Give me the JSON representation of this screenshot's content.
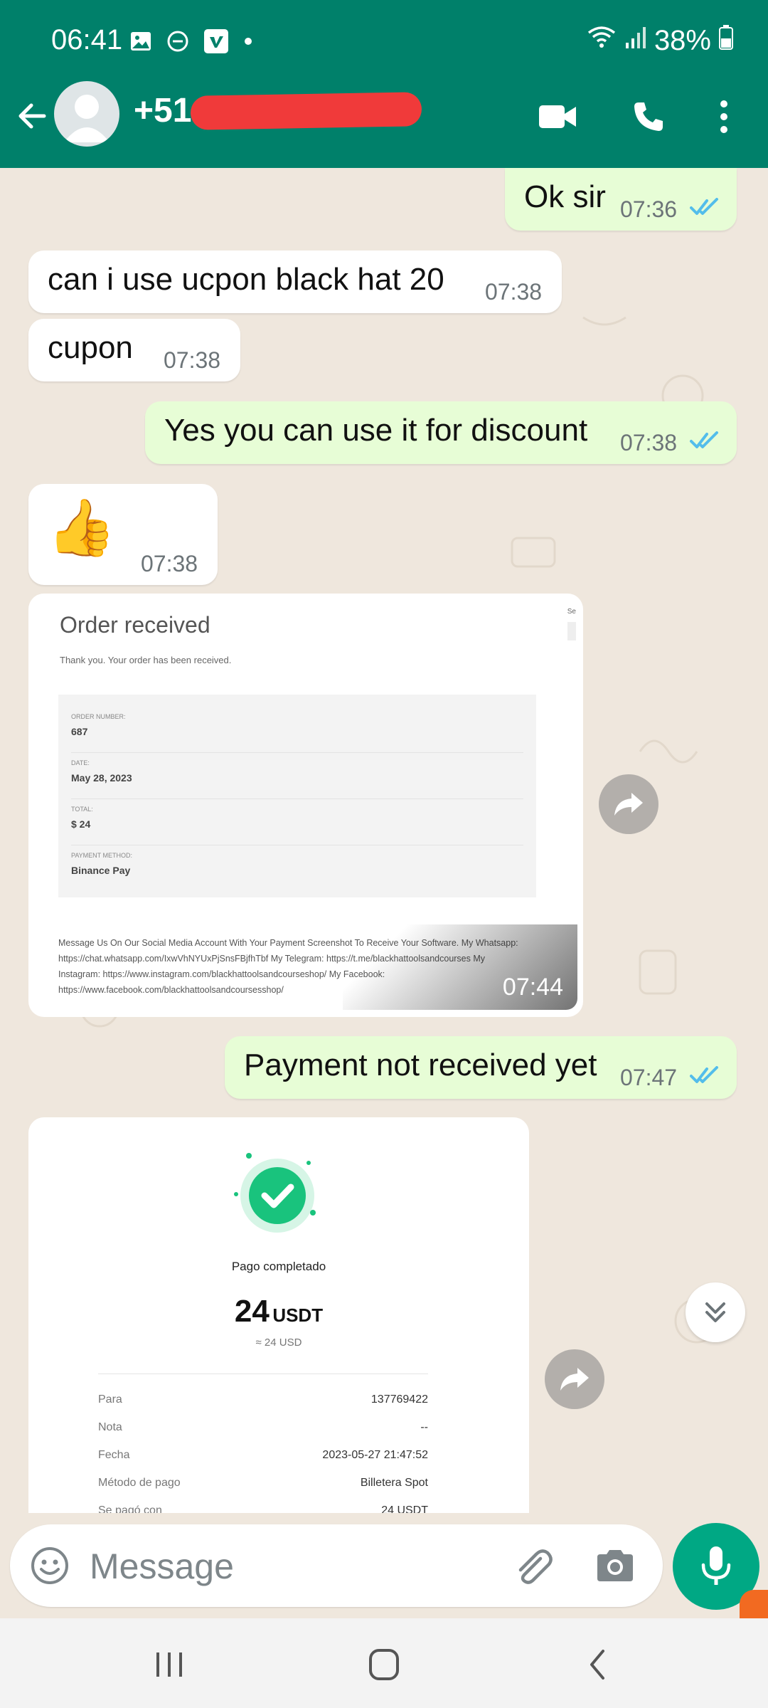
{
  "status_bar": {
    "time": "06:41",
    "battery": "38%",
    "icons": [
      "gallery-icon",
      "dnd-icon",
      "vimeo-icon",
      "dot-icon",
      "wifi-icon",
      "signal-icon",
      "battery-icon"
    ]
  },
  "header": {
    "contact": "+51 ",
    "icons": [
      "back-arrow-icon",
      "avatar",
      "video-call-icon",
      "phone-call-icon",
      "more-options-icon"
    ]
  },
  "messages": [
    {
      "type": "outgoing",
      "text": "Ok sir",
      "time": "07:36",
      "read": true
    },
    {
      "type": "incoming",
      "text": "can i use ucpon black hat 20",
      "time": "07:38"
    },
    {
      "type": "incoming",
      "text": "cupon",
      "time": "07:38"
    },
    {
      "type": "outgoing",
      "text": "Yes you can use it for discount",
      "time": "07:38",
      "read": true
    },
    {
      "type": "incoming",
      "emoji": "👍",
      "time": "07:38"
    },
    {
      "type": "incoming-image",
      "time": "07:44"
    },
    {
      "type": "outgoing",
      "text": "Payment not received yet",
      "time": "07:47",
      "read": true
    },
    {
      "type": "incoming-image"
    }
  ],
  "order_image": {
    "title": "Order received",
    "subtitle": "Thank you. Your order has been received.",
    "side_text": "Se",
    "rows": [
      {
        "label": "ORDER NUMBER:",
        "value": "687"
      },
      {
        "label": "DATE:",
        "value": "May 28, 2023"
      },
      {
        "label": "TOTAL:",
        "value": "$ 24"
      },
      {
        "label": "PAYMENT METHOD:",
        "value": "Binance Pay"
      }
    ],
    "message_lines": [
      "Message Us On Our Social Media Account With Your Payment Screenshot To Receive Your Software. My Whatsapp:",
      "https://chat.whatsapp.com/IxwVhNYUxPjSnsFBjfhTbf My Telegram: https://t.me/blackhattoolsandcourses My",
      "Instagram: https://www.instagram.com/blackhattoolsandcourseshop/ My Facebook:",
      "https://www.facebook.com/blackhattoolsandcoursesshop/"
    ]
  },
  "payment_image": {
    "status": "Pago completado",
    "amount": "24",
    "currency": "USDT",
    "approx": "≈ 24 USD",
    "details": [
      {
        "label": "Para",
        "value": "137769422"
      },
      {
        "label": "Nota",
        "value": "--"
      },
      {
        "label": "Fecha",
        "value": "2023-05-27 21:47:52"
      },
      {
        "label": "Método de pago",
        "value": "Billetera Spot"
      },
      {
        "label": "Se pagó con",
        "value": "24 USDT"
      }
    ]
  },
  "composer": {
    "placeholder": "Message"
  },
  "colors": {
    "header": "#00806a",
    "outgoing_bubble": "#e7fdd6",
    "incoming_bubble": "#ffffff",
    "chat_bg": "#efe7dd",
    "read_ticks": "#53bdeb",
    "mic_button": "#00a884",
    "redaction": "#f03a3a"
  }
}
